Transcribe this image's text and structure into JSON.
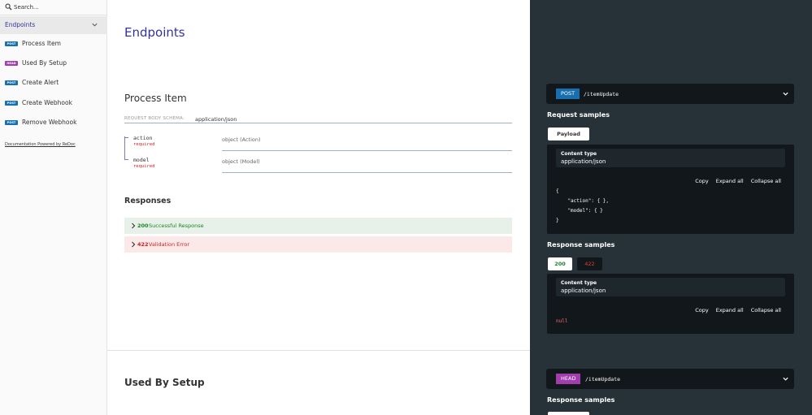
{
  "sidebar": {
    "search_placeholder": "Search...",
    "group_label": "Endpoints",
    "items": [
      {
        "method": "POST",
        "label": "Process Item"
      },
      {
        "method": "HEAD",
        "label": "Used By Setup"
      },
      {
        "method": "POST",
        "label": "Create Alert"
      },
      {
        "method": "POST",
        "label": "Create Webhook"
      },
      {
        "method": "POST",
        "label": "Remove Webhook"
      }
    ],
    "powered_by": "Documentation Powered by ReDoc"
  },
  "middle": {
    "section_title": "Endpoints",
    "operation_title": "Process Item",
    "request_body_label": "REQUEST BODY SCHEMA:",
    "request_body_type": "application/json",
    "properties": [
      {
        "name": "action",
        "required": "required",
        "type": "object (Action)"
      },
      {
        "name": "model",
        "required": "required",
        "type": "object (Model)"
      }
    ],
    "responses_title": "Responses",
    "responses": [
      {
        "code": "200",
        "description": "Successful Response"
      },
      {
        "code": "422",
        "description": "Validation Error"
      }
    ],
    "next_operation_title": "Used By Setup"
  },
  "right": {
    "op1": {
      "method": "POST",
      "path": "/itemUpdate",
      "request_samples_title": "Request samples",
      "payload_tab": "Payload",
      "content_type_label": "Content type",
      "content_type_value": "application/json",
      "copy": "Copy",
      "expand_all": "Expand all",
      "collapse_all": "Collapse all",
      "code_lines": [
        "{",
        "    \"action\": { },",
        "    \"model\": { }",
        "}"
      ],
      "response_samples_title": "Response samples",
      "tab_200": "200",
      "tab_422": "422",
      "resp_content_type_label": "Content type",
      "resp_content_type_value": "application/json",
      "resp_copy": "Copy",
      "resp_expand_all": "Expand all",
      "resp_collapse_all": "Collapse all",
      "resp_body": "null"
    },
    "op2": {
      "method": "HEAD",
      "path": "/itemUpdate",
      "response_samples_title": "Response samples"
    }
  },
  "colors": {
    "post": "#186faf",
    "head": "#a23dad",
    "success": "#1d8127",
    "error": "#d41f1c",
    "panel": "#263238",
    "panel_dark": "#11171a",
    "accent": "#32329f"
  }
}
